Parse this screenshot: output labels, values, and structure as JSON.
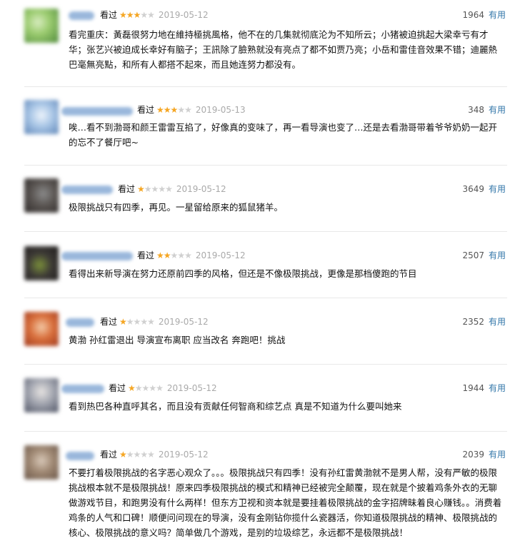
{
  "useful_label": "有用",
  "star_color": "#f5a623",
  "comments": [
    {
      "status": "看过",
      "stars": 3,
      "date": "2019-05-12",
      "votes": "1964",
      "text": "看完重庆：黃磊很努力地在維持極挑風格，他不在的几集就彻底沦为不知所云；小猪被迫挑起大梁幸亏有才华；张艺兴被迫成长幸好有脑子；王訊除了臉熟就没有亮点了都不如贾乃亮；小岳和雷佳音效果不错；迪麗熱巴毫無亮點，和所有人都搭不起來，而且她连努力都没有。"
    },
    {
      "status": "看过",
      "stars": 3,
      "date": "2019-05-13",
      "votes": "348",
      "text": "唉…看不到渤哥和颜王雷雷互掐了，好像真的变味了，再一看导演也变了…还是去看渤哥带着爷爷奶奶一起开的忘不了餐厅吧~"
    },
    {
      "status": "看过",
      "stars": 1,
      "date": "2019-05-12",
      "votes": "3649",
      "text": "极限挑战只有四季，再见。一星留给原来的狐鼠猪羊。"
    },
    {
      "status": "看过",
      "stars": 2,
      "date": "2019-05-12",
      "votes": "2507",
      "text": "看得出来新导演在努力还原前四季的风格，但还是不像极限挑战，更像是那档傻跑的节目"
    },
    {
      "status": "看过",
      "stars": 1,
      "date": "2019-05-12",
      "votes": "2352",
      "text": "黄渤 孙红雷退出 导演宣布离职 应当改名 奔跑吧！挑战"
    },
    {
      "status": "看过",
      "stars": 1,
      "date": "2019-05-12",
      "votes": "1944",
      "text": "看到热巴各种直呼其名，而且没有贡献任何智商和综艺点 真是不知道为什么要叫她来"
    },
    {
      "status": "看过",
      "stars": 1,
      "date": "2019-05-12",
      "votes": "2039",
      "text": "不要打着极限挑战的名字恶心观众了。。。极限挑战只有四季！没有孙红雷黄渤就不是男人帮，没有严敏的极限挑战根本就不是极限挑战！原来四季极限挑战的模式和精神已经被完全颠覆，现在就是个披着鸡条外衣的无聊做游戏节目，和跑男没有什么两样！但东方卫视和资本就是要挂着极限挑战的金字招牌昧着良心赚钱。。消费着鸡条的人气和口碑！顺便问问现在的导演，没有金刚钻你揽什么瓷器活，你知道极限挑战的精神、极限挑战的核心、极限挑战的意义吗？简单做几个游戏，是别的垃圾综艺，永远都不是极限挑战！"
    }
  ]
}
